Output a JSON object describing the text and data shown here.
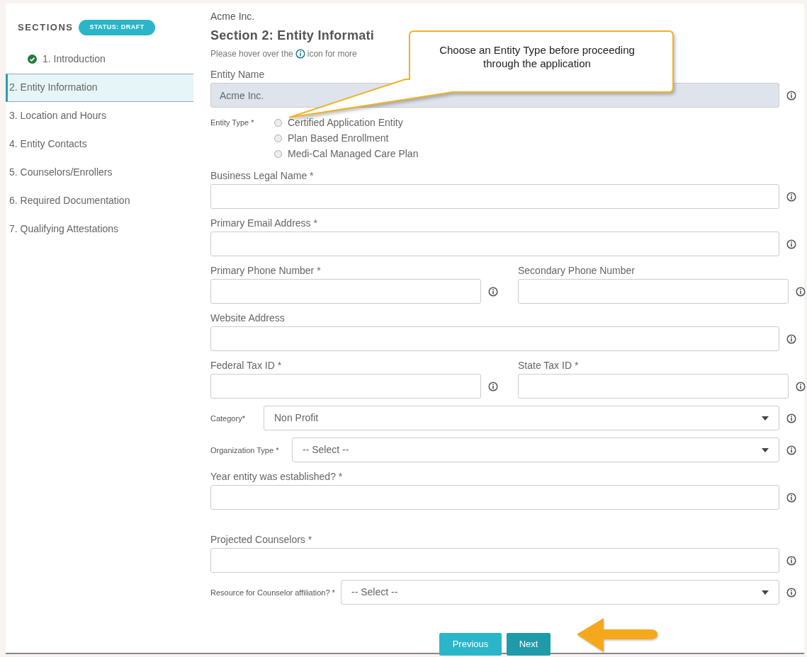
{
  "sidebar": {
    "heading": "SECTIONS",
    "status_badge": "STATUS: DRAFT",
    "items": [
      {
        "label": "1. Introduction",
        "selected": false,
        "completed": true
      },
      {
        "label": "2. Entity Information",
        "selected": true,
        "completed": false
      },
      {
        "label": "3. Location and Hours",
        "selected": false,
        "completed": false
      },
      {
        "label": "4. Entity Contacts",
        "selected": false,
        "completed": false
      },
      {
        "label": "5. Counselors/Enrollers",
        "selected": false,
        "completed": false
      },
      {
        "label": "6. Required Documentation",
        "selected": false,
        "completed": false
      },
      {
        "label": "7. Qualifying Attestations",
        "selected": false,
        "completed": false
      }
    ]
  },
  "header": {
    "organization": "Acme Inc.",
    "title": "Section 2: Entity Informati",
    "hint_before": "Please hover over the",
    "hint_after": "icon for more"
  },
  "callout": {
    "text": "Choose an Entity Type before proceeding through the application"
  },
  "rows": [
    {
      "kind": "text",
      "label": "Entity Name",
      "value": "Acme Inc.",
      "disabled": true
    },
    {
      "kind": "radio",
      "label": "Entity Type *",
      "options": [
        {
          "label": "Certified Application Entity",
          "selected": false
        },
        {
          "label": "Plan Based Enrollment",
          "selected": false
        },
        {
          "label": "Medi-Cal Managed Care Plan",
          "selected": false
        }
      ]
    },
    {
      "kind": "text",
      "label": "Business Legal Name *",
      "disabled": false
    },
    {
      "kind": "text",
      "label": "Primary Email Address *",
      "disabled": false
    },
    {
      "kind": "pair",
      "fields": [
        {
          "label": "Primary Phone Number *"
        },
        {
          "label": "Secondary Phone Number"
        }
      ]
    },
    {
      "kind": "text",
      "label": "Website Address",
      "disabled": false
    },
    {
      "kind": "pair",
      "fields": [
        {
          "label": "Federal Tax ID *"
        },
        {
          "label": "State Tax ID *"
        }
      ]
    },
    {
      "kind": "select",
      "label": "Category*",
      "value": "Non Profit"
    },
    {
      "kind": "select",
      "label": "Organization Type *",
      "value": "-- Select --"
    },
    {
      "kind": "text",
      "label": "Year entity was established? *",
      "disabled": false
    },
    {
      "kind": "text",
      "label": "Projected Counselors *",
      "disabled": false
    },
    {
      "kind": "select",
      "label": "Resource for Counselor affiliation? *",
      "value": "-- Select --"
    }
  ],
  "buttons": [
    {
      "label": "Previous",
      "kind": "secondary"
    },
    {
      "label": "Next",
      "kind": "primary"
    }
  ]
}
